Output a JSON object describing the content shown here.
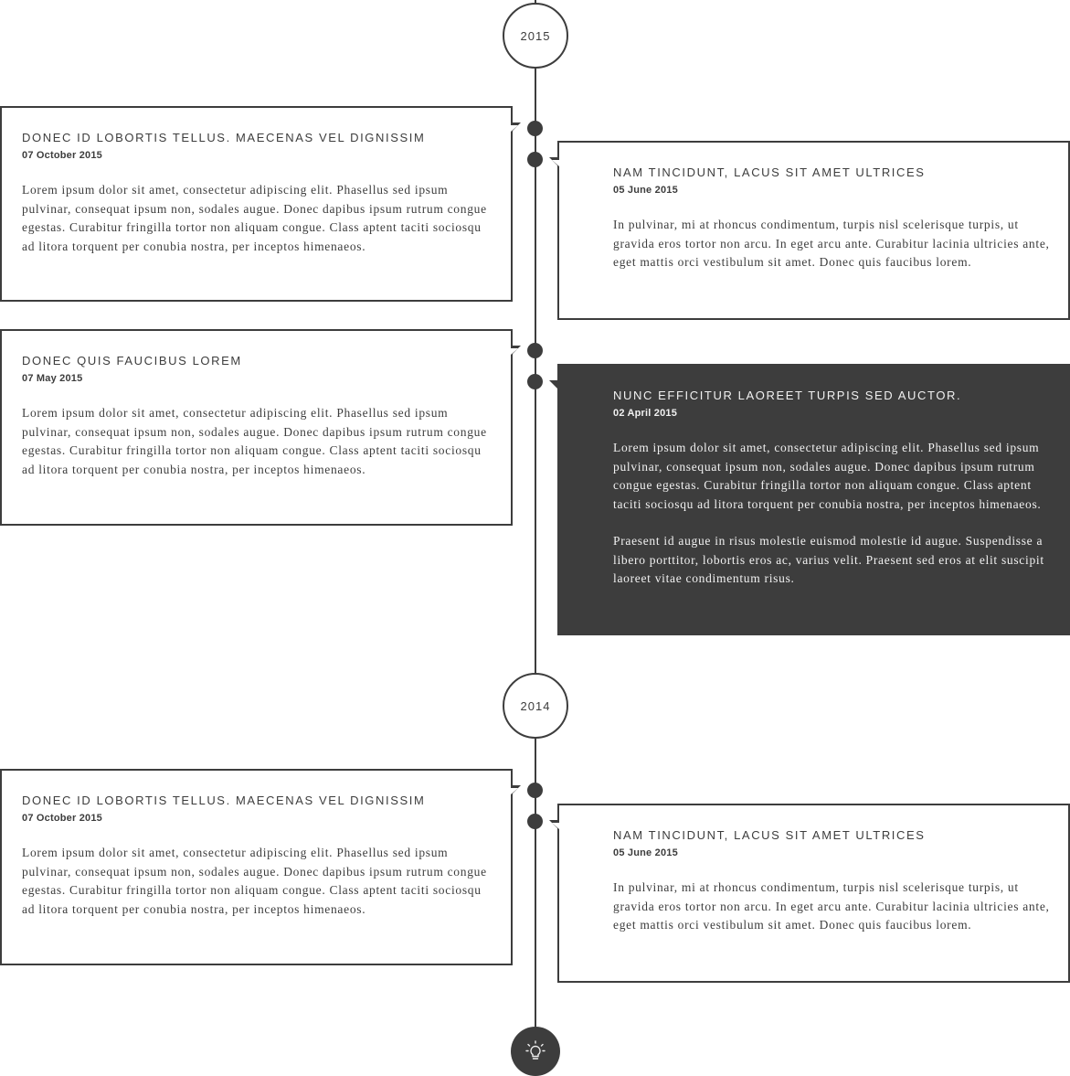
{
  "timeline": {
    "years": [
      {
        "label": "2015"
      },
      {
        "label": "2014"
      }
    ],
    "entries": [
      {
        "title": "DONEC ID LOBORTIS TELLUS. MAECENAS VEL DIGNISSIM",
        "date": "07 October 2015",
        "paragraphs": [
          "Lorem ipsum dolor sit amet, consectetur adipiscing elit. Phasellus sed ipsum pulvinar, consequat ipsum non, sodales augue. Donec dapibus ipsum rutrum congue egestas. Curabitur fringilla tortor non aliquam congue. Class aptent taciti sociosqu ad litora torquent per conubia nostra, per inceptos himenaeos."
        ]
      },
      {
        "title": "NAM TINCIDUNT, LACUS SIT AMET ULTRICES",
        "date": "05 June 2015",
        "paragraphs": [
          "In pulvinar, mi at rhoncus condimentum, turpis nisl scelerisque turpis, ut gravida eros tortor non arcu. In eget arcu ante. Curabitur lacinia ultricies ante, eget mattis orci vestibulum sit amet. Donec quis faucibus lorem."
        ]
      },
      {
        "title": "DONEC QUIS FAUCIBUS LOREM",
        "date": "07 May 2015",
        "paragraphs": [
          "Lorem ipsum dolor sit amet, consectetur adipiscing elit. Phasellus sed ipsum pulvinar, consequat ipsum non, sodales augue. Donec dapibus ipsum rutrum congue egestas. Curabitur fringilla tortor non aliquam congue. Class aptent taciti sociosqu ad litora torquent per conubia nostra, per inceptos himenaeos."
        ]
      },
      {
        "title": "NUNC EFFICITUR LAOREET TURPIS SED AUCTOR.",
        "date": "02 April 2015",
        "paragraphs": [
          "Lorem ipsum dolor sit amet, consectetur adipiscing elit. Phasellus sed ipsum pulvinar, consequat ipsum non, sodales augue. Donec dapibus ipsum rutrum congue egestas. Curabitur fringilla tortor non aliquam congue. Class aptent taciti sociosqu ad litora torquent per conubia nostra, per inceptos himenaeos.",
          "Praesent id augue in risus molestie euismod molestie id augue. Suspendisse a libero porttitor, lobortis eros ac, varius velit. Praesent sed eros at elit suscipit laoreet vitae condimentum risus."
        ]
      },
      {
        "title": "DONEC ID LOBORTIS TELLUS. MAECENAS VEL DIGNISSIM",
        "date": "07 October 2015",
        "paragraphs": [
          "Lorem ipsum dolor sit amet, consectetur adipiscing elit. Phasellus sed ipsum pulvinar, consequat ipsum non, sodales augue. Donec dapibus ipsum rutrum congue egestas. Curabitur fringilla tortor non aliquam congue. Class aptent taciti sociosqu ad litora torquent per conubia nostra, per inceptos himenaeos."
        ]
      },
      {
        "title": "NAM TINCIDUNT, LACUS SIT AMET ULTRICES",
        "date": "05 June 2015",
        "paragraphs": [
          "In pulvinar, mi at rhoncus condimentum, turpis nisl scelerisque turpis, ut gravida eros tortor non arcu. In eget arcu ante. Curabitur lacinia ultricies ante, eget mattis orci vestibulum sit amet. Donec quis faucibus lorem."
        ]
      }
    ],
    "end_icon": "lightbulb-icon",
    "colors": {
      "primary": "#3d3d3d",
      "background": "#ffffff",
      "dark_text": "#f1f1f1"
    }
  }
}
